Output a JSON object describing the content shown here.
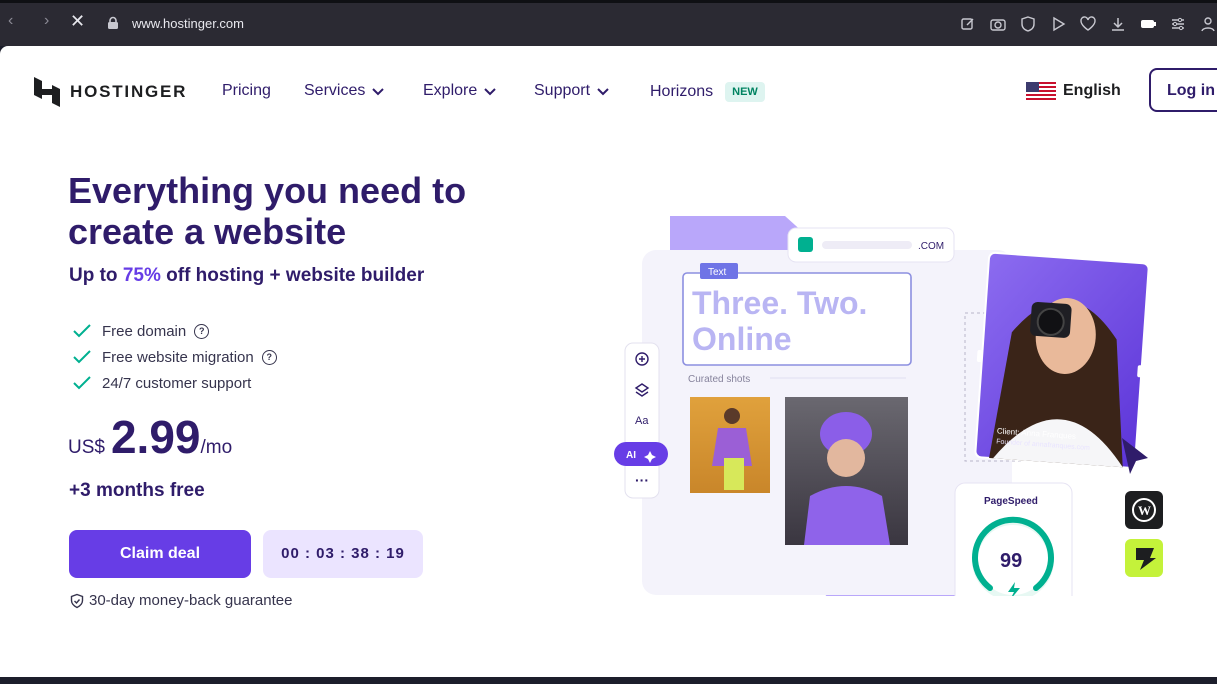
{
  "browser": {
    "url": "www.hostinger.com"
  },
  "nav": {
    "brand": "HOSTINGER",
    "items": [
      {
        "label": "Pricing",
        "has_dropdown": false
      },
      {
        "label": "Services",
        "has_dropdown": true
      },
      {
        "label": "Explore",
        "has_dropdown": true
      },
      {
        "label": "Support",
        "has_dropdown": true
      },
      {
        "label": "Horizons",
        "has_dropdown": false,
        "badge": "NEW"
      }
    ],
    "language": "English",
    "login_label": "Log in"
  },
  "hero": {
    "title": "Everything you need to create a website",
    "subtitle_pre": "Up to ",
    "subtitle_accent": "75%",
    "subtitle_post": " off hosting + website builder",
    "features": [
      {
        "label": "Free domain",
        "has_help": true
      },
      {
        "label": "Free website migration",
        "has_help": true
      },
      {
        "label": "24/7 customer support",
        "has_help": false
      }
    ],
    "currency": "US$",
    "price": "2.99",
    "period": "/mo",
    "bonus": "+3 months free",
    "cta_label": "Claim deal",
    "countdown": "00 : 03 : 38 : 19",
    "guarantee": "30-day money-back guarantee"
  },
  "illustration": {
    "domain_suffix": ".COM",
    "text_tag": "Text",
    "headline_line1": "Three. Two.",
    "headline_line2": "Online",
    "gallery_label": "Curated shots",
    "ai_label": "AI",
    "client_name": "Client: Anna Franques",
    "client_role": "Founder of annafranques.com",
    "pagespeed_label": "PageSpeed",
    "pagespeed_score": "99"
  },
  "colors": {
    "brand_dark": "#2f1c6a",
    "brand_primary": "#673de6",
    "brand_light": "#ebe4ff",
    "check_green": "#00b090",
    "new_badge_bg": "#def4f0",
    "new_badge_text": "#008361"
  },
  "icons": [
    "back-arrow-icon",
    "forward-arrow-icon",
    "stop-loading-icon",
    "lock-icon",
    "check-icon",
    "help-circle-icon",
    "chevron-down-icon",
    "us-flag-icon",
    "shield-check-icon",
    "wordpress-icon",
    "lightning-icon",
    "cursor-arrow-icon"
  ]
}
